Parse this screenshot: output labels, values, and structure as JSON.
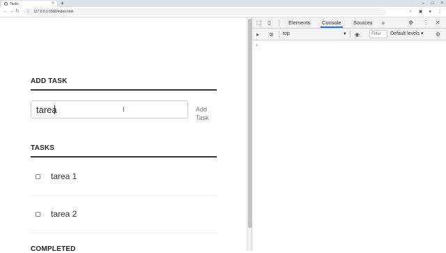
{
  "browser": {
    "tab_title": "Tasks",
    "tab_close": "×",
    "new_tab": "+",
    "window_controls": [
      "–",
      "□",
      "×"
    ],
    "address": "127.0.0.1:5500/index.html",
    "nav": {
      "back": "←",
      "forward": "→",
      "reload": "↻"
    }
  },
  "page": {
    "add_task_heading": "ADD TASK",
    "new_task_value": "tarea",
    "add_button_label": "Add\nTask",
    "tasks_heading": "TASKS",
    "tasks": [
      {
        "label": "tarea 1",
        "checked": false
      },
      {
        "label": "tarea 2",
        "checked": false
      }
    ],
    "completed_heading": "COMPLETED"
  },
  "devtools": {
    "tabs": [
      "Elements",
      "Console",
      "Sources"
    ],
    "active_tab": "Console",
    "more_tabs": "»",
    "context": "top",
    "filter_placeholder": "Filter",
    "levels": "Default levels ▾",
    "prompt": "›",
    "accent_color": "#1a73e8"
  }
}
